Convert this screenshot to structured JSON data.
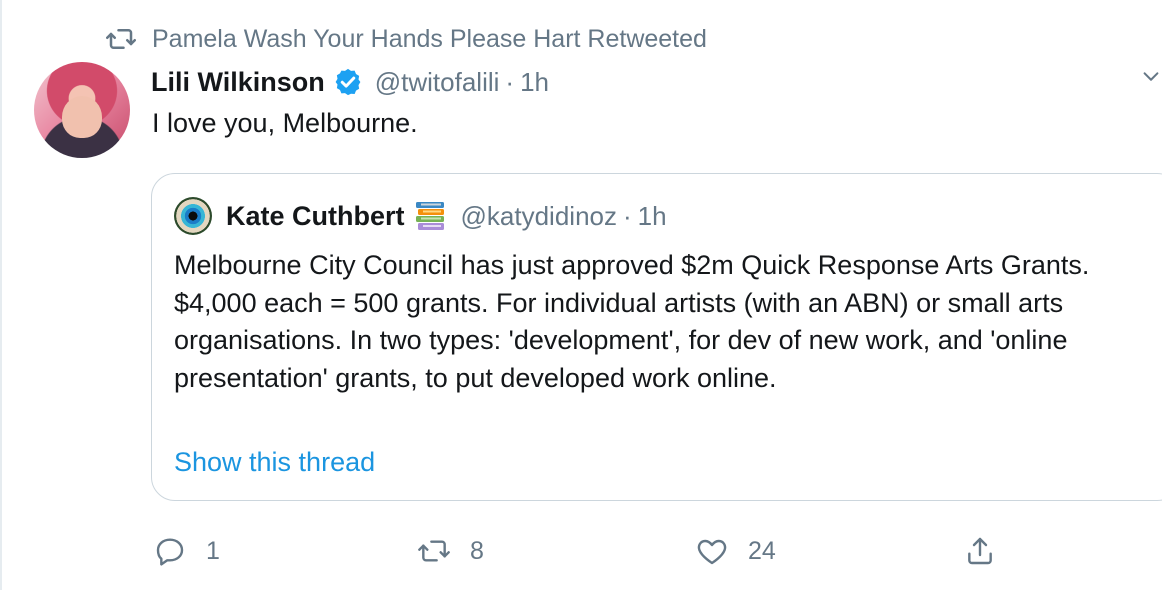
{
  "retweet_context": {
    "icon": "retweet-icon",
    "text": "Pamela Wash Your Hands Please Hart Retweeted"
  },
  "tweet": {
    "author_name": "Lili Wilkinson",
    "verified_icon": "verified-badge-icon",
    "handle": "@twitofalili",
    "separator": "·",
    "time": "1h",
    "text": "I love you, Melbourne.",
    "more_icon": "chevron-down-icon"
  },
  "quote": {
    "author_name": "Kate Cuthbert",
    "emoji_icon": "books-emoji-icon",
    "handle": "@katydidinoz",
    "separator": "·",
    "time": "1h",
    "lines": [
      "Melbourne City Council has just approved $2m  Quick Response Arts Grants.",
      "$4,000 each = 500 grants. For individual artists (with an ABN) or small arts organisations. In two types: 'development', for dev of new work, and 'online presentation' grants, to put developed work online."
    ],
    "show_thread": "Show this thread"
  },
  "actions": {
    "reply": {
      "icon": "reply-icon",
      "count": "1"
    },
    "retweet": {
      "icon": "retweet-icon",
      "count": "8"
    },
    "like": {
      "icon": "heart-icon",
      "count": "24"
    },
    "share": {
      "icon": "share-icon"
    }
  },
  "colors": {
    "text": "#14171a",
    "secondary": "#657786",
    "link": "#1b95e0",
    "verified": "#1da1f2",
    "border": "#ccd6dd"
  }
}
